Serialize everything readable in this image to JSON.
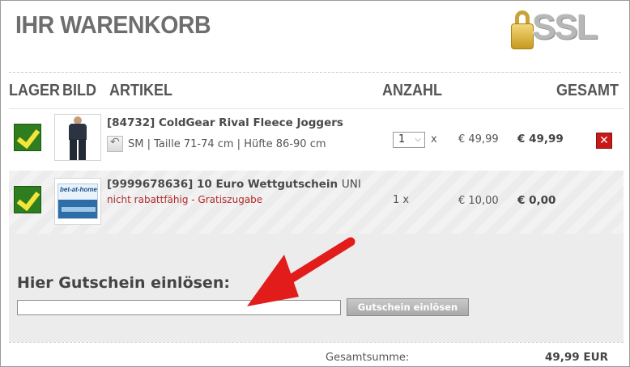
{
  "header": {
    "title": "IHR WARENKORB",
    "ssl_badge_text": "SSL",
    "ssl_icon": "lock-icon"
  },
  "table": {
    "columns": {
      "lager": "LAGER",
      "bild": "BILD",
      "artikel": "ARTIKEL",
      "anzahl": "ANZAHL",
      "gesamt": "GESAMT"
    },
    "rows": [
      {
        "stock_icon": "checkmark-icon",
        "image_icon": "joggers-product-image",
        "id_label": "[84732] ColdGear Rival Fleece Joggers",
        "name_suffix": "",
        "variant": "SM | Taille 71-74 cm | Hüfte 86-90 cm",
        "note": "",
        "quantity": "1",
        "quantity_suffix": "x",
        "unit_price": "€ 49,99",
        "total_price": "€ 49,99",
        "removable": true
      },
      {
        "stock_icon": "checkmark-icon",
        "image_icon": "voucher-product-image",
        "id_label": "[9999678636] 10 Euro Wettgutschein",
        "name_suffix": "UNI",
        "variant": "",
        "note": "nicht rabattfähig - Gratiszugabe",
        "quantity": "1",
        "quantity_suffix": "x",
        "unit_price": "€ 10,00",
        "total_price": "€ 0,00",
        "removable": false
      }
    ],
    "voucher_image_logo": "bet-at-home"
  },
  "voucher": {
    "heading": "Hier Gutschein einlösen:",
    "input_value": "",
    "button_label": "Gutschein einlösen"
  },
  "summary": {
    "label": "Gesamtsumme:",
    "value": "49,99 EUR"
  },
  "colors": {
    "remove_button": "#c81818",
    "note_text": "#b22a2a",
    "arrow": "#e21b1b",
    "stock_check": "#f4e53a"
  }
}
